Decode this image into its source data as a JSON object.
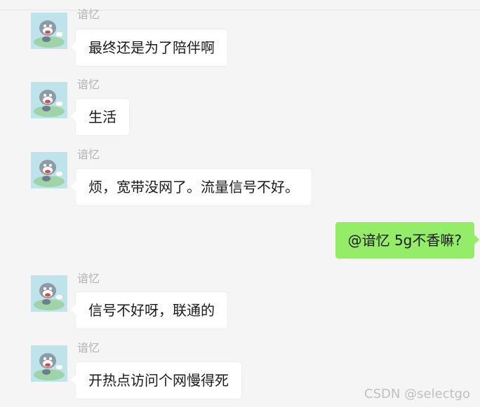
{
  "messages": [
    {
      "sender": "谙忆",
      "text": "最终还是为了陪伴啊",
      "self": false
    },
    {
      "sender": "谙忆",
      "text": "生活",
      "self": false
    },
    {
      "sender": "谙忆",
      "text": "烦，宽带没网了。流量信号不好。",
      "self": false
    },
    {
      "sender": "",
      "text": "@谙忆 5g不香嘛?",
      "self": true
    },
    {
      "sender": "谙忆",
      "text": "信号不好呀，联通的",
      "self": false
    },
    {
      "sender": "谙忆",
      "text": "开热点访问个网慢得死",
      "self": false
    }
  ],
  "watermark": "CSDN @selectgo",
  "colors": {
    "background": "#f5f5f5",
    "bubble_incoming": "#ffffff",
    "bubble_outgoing": "#95ec69",
    "sender_name": "#b2b2b2"
  }
}
